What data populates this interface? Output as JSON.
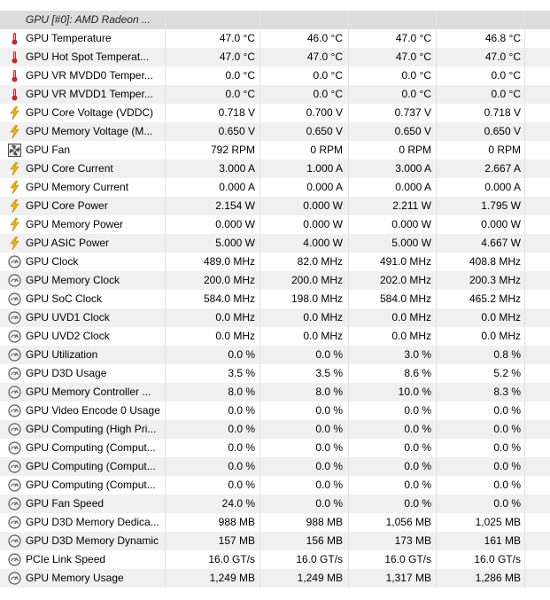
{
  "group_title": "GPU [#0]: AMD Radeon ...",
  "rows": [
    {
      "label": "GPU Temperature",
      "icon": "thermometer-icon",
      "values": [
        "47.0 °C",
        "46.0 °C",
        "47.0 °C",
        "46.8 °C"
      ]
    },
    {
      "label": "GPU Hot Spot Temperat...",
      "icon": "thermometer-icon",
      "values": [
        "47.0 °C",
        "47.0 °C",
        "47.0 °C",
        "47.0 °C"
      ]
    },
    {
      "label": "GPU VR MVDD0 Temper...",
      "icon": "thermometer-icon",
      "values": [
        "0.0 °C",
        "0.0 °C",
        "0.0 °C",
        "0.0 °C"
      ]
    },
    {
      "label": "GPU VR MVDD1 Temper...",
      "icon": "thermometer-icon",
      "values": [
        "0.0 °C",
        "0.0 °C",
        "0.0 °C",
        "0.0 °C"
      ]
    },
    {
      "label": "GPU Core Voltage (VDDC)",
      "icon": "lightning-icon",
      "values": [
        "0.718 V",
        "0.700 V",
        "0.737 V",
        "0.718 V"
      ]
    },
    {
      "label": "GPU Memory Voltage (M...",
      "icon": "lightning-icon",
      "values": [
        "0.650 V",
        "0.650 V",
        "0.650 V",
        "0.650 V"
      ]
    },
    {
      "label": "GPU Fan",
      "icon": "fan-icon",
      "values": [
        "792 RPM",
        "0 RPM",
        "0 RPM",
        "0 RPM"
      ]
    },
    {
      "label": "GPU Core Current",
      "icon": "lightning-icon",
      "values": [
        "3.000 A",
        "1.000 A",
        "3.000 A",
        "2.667 A"
      ]
    },
    {
      "label": "GPU Memory Current",
      "icon": "lightning-icon",
      "values": [
        "0.000 A",
        "0.000 A",
        "0.000 A",
        "0.000 A"
      ]
    },
    {
      "label": "GPU Core Power",
      "icon": "lightning-icon",
      "values": [
        "2.154 W",
        "0.000 W",
        "2.211 W",
        "1.795 W"
      ]
    },
    {
      "label": "GPU Memory Power",
      "icon": "lightning-icon",
      "values": [
        "0.000 W",
        "0.000 W",
        "0.000 W",
        "0.000 W"
      ]
    },
    {
      "label": "GPU ASIC Power",
      "icon": "lightning-icon",
      "values": [
        "5.000 W",
        "4.000 W",
        "5.000 W",
        "4.667 W"
      ]
    },
    {
      "label": "GPU Clock",
      "icon": "gauge-icon",
      "values": [
        "489.0 MHz",
        "82.0 MHz",
        "491.0 MHz",
        "408.8 MHz"
      ]
    },
    {
      "label": "GPU Memory Clock",
      "icon": "gauge-icon",
      "values": [
        "200.0 MHz",
        "200.0 MHz",
        "202.0 MHz",
        "200.3 MHz"
      ]
    },
    {
      "label": "GPU SoC Clock",
      "icon": "gauge-icon",
      "values": [
        "584.0 MHz",
        "198.0 MHz",
        "584.0 MHz",
        "465.2 MHz"
      ]
    },
    {
      "label": "GPU UVD1 Clock",
      "icon": "gauge-icon",
      "values": [
        "0.0 MHz",
        "0.0 MHz",
        "0.0 MHz",
        "0.0 MHz"
      ]
    },
    {
      "label": "GPU UVD2 Clock",
      "icon": "gauge-icon",
      "values": [
        "0.0 MHz",
        "0.0 MHz",
        "0.0 MHz",
        "0.0 MHz"
      ]
    },
    {
      "label": "GPU Utilization",
      "icon": "gauge-icon",
      "values": [
        "0.0 %",
        "0.0 %",
        "3.0 %",
        "0.8 %"
      ]
    },
    {
      "label": "GPU D3D Usage",
      "icon": "gauge-icon",
      "values": [
        "3.5 %",
        "3.5 %",
        "8.6 %",
        "5.2 %"
      ]
    },
    {
      "label": "GPU Memory Controller ...",
      "icon": "gauge-icon",
      "values": [
        "8.0 %",
        "8.0 %",
        "10.0 %",
        "8.3 %"
      ]
    },
    {
      "label": "GPU Video Encode 0 Usage",
      "icon": "gauge-icon",
      "values": [
        "0.0 %",
        "0.0 %",
        "0.0 %",
        "0.0 %"
      ]
    },
    {
      "label": "GPU Computing (High Pri...",
      "icon": "gauge-icon",
      "values": [
        "0.0 %",
        "0.0 %",
        "0.0 %",
        "0.0 %"
      ]
    },
    {
      "label": "GPU Computing (Comput...",
      "icon": "gauge-icon",
      "values": [
        "0.0 %",
        "0.0 %",
        "0.0 %",
        "0.0 %"
      ]
    },
    {
      "label": "GPU Computing (Comput...",
      "icon": "gauge-icon",
      "values": [
        "0.0 %",
        "0.0 %",
        "0.0 %",
        "0.0 %"
      ]
    },
    {
      "label": "GPU Computing (Comput...",
      "icon": "gauge-icon",
      "values": [
        "0.0 %",
        "0.0 %",
        "0.0 %",
        "0.0 %"
      ]
    },
    {
      "label": "GPU Fan Speed",
      "icon": "gauge-icon",
      "values": [
        "24.0 %",
        "0.0 %",
        "0.0 %",
        "0.0 %"
      ]
    },
    {
      "label": "GPU D3D Memory Dedica...",
      "icon": "gauge-icon",
      "values": [
        "988 MB",
        "988 MB",
        "1,056 MB",
        "1,025 MB"
      ]
    },
    {
      "label": "GPU D3D Memory Dynamic",
      "icon": "gauge-icon",
      "values": [
        "157 MB",
        "156 MB",
        "173 MB",
        "161 MB"
      ]
    },
    {
      "label": "PCIe Link Speed",
      "icon": "gauge-icon",
      "values": [
        "16.0 GT/s",
        "16.0 GT/s",
        "16.0 GT/s",
        "16.0 GT/s"
      ]
    },
    {
      "label": "GPU Memory Usage",
      "icon": "gauge-icon",
      "values": [
        "1,249 MB",
        "1,249 MB",
        "1,317 MB",
        "1,286 MB"
      ]
    }
  ],
  "colors": {
    "thermometer": "#c62828",
    "lightning": "#f2b600",
    "lightning_edge": "#b07a00",
    "gauge": "#5a5a5a",
    "fan": "#4a4a4a",
    "header_bg": "#dcdcdc",
    "row_alt_bg": "#f0f0f0"
  }
}
